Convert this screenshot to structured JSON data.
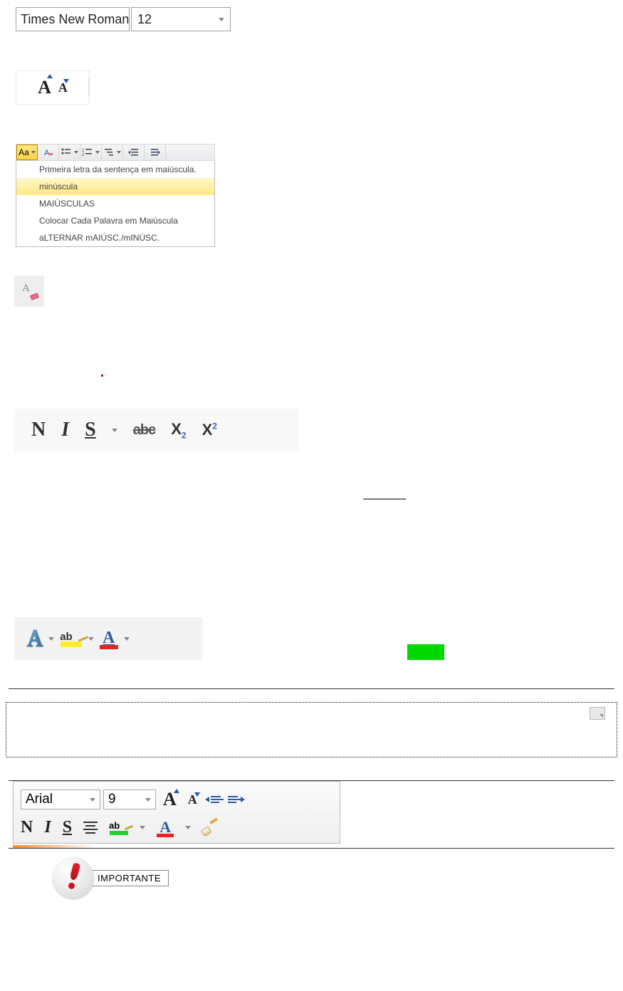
{
  "fontPicker": {
    "fontName": "Times New Roman",
    "fontSize": "12"
  },
  "caseMenu": {
    "button": "Aa",
    "items": [
      "Primeira letra da sentença em maiúscula.",
      "minúscula",
      "MAIÚSCULAS",
      "Colocar Cada Palavra em Maiúscula",
      "aLTERNAR mAIÚSC./mINÚSC."
    ]
  },
  "growShrink": {
    "growLabel": "A",
    "shrinkLabel": "A"
  },
  "formatRow": {
    "bold": "N",
    "italic": "I",
    "underline": "S",
    "strike": "abc",
    "subscript": "X",
    "subscriptIndex": "2",
    "superscript": "X",
    "superscriptIndex": "2"
  },
  "effects": {
    "textEffectLetter": "A",
    "highlightText": "ab",
    "fontColorLetter": "A"
  },
  "miniToolbar": {
    "fontName": "Arial",
    "fontSize": "9",
    "growLabel": "A",
    "shrinkLabel": "A",
    "bold": "N",
    "italic": "I",
    "underline": "S",
    "highlightText": "ab",
    "fontColorLetter": "A"
  },
  "importante": {
    "label": "IMPORTANTE"
  }
}
